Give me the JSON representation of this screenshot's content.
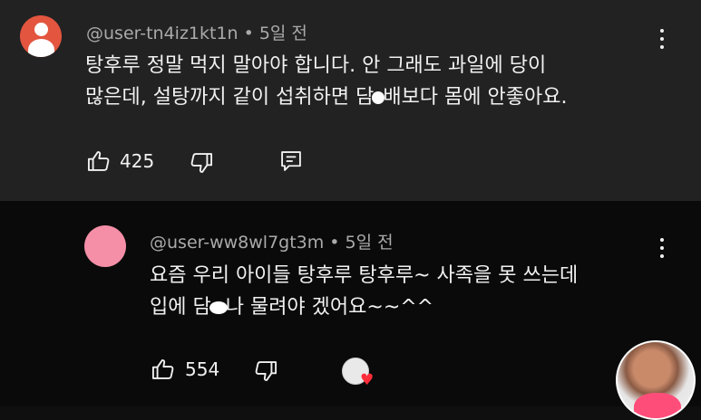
{
  "comments": [
    {
      "author": "@user-tn4iz1kt1n",
      "time": "5일 전",
      "line1": "탕후루 정말 먹지 말아야 합니다. 안 그래도 과일에 당이",
      "line2_a": "많은데, 설탕까지 같이 섭취하면 담",
      "line2_b": "배보다 몸에 안좋아요.",
      "likes": "425"
    },
    {
      "author": "@user-ww8wl7gt3m",
      "time": "5일 전",
      "line1": "요즘 우리 아이들 탕후루 탕후루~ 사족을 못 쓰는데",
      "line2_a": "입에 담",
      "line2_b": "나 물려야 겠어요~~^^",
      "likes": "554"
    }
  ],
  "colors": {
    "top_bg": "#222222",
    "bottom_bg": "#0a0a0a",
    "avatar_default": "#e3553f",
    "avatar_pink": "#f58fa8",
    "meta_text": "#aaaaaa",
    "heart": "#ff2d3a"
  },
  "icons": {
    "like": "thumbs-up-icon",
    "dislike": "thumbs-down-icon",
    "reply": "reply-icon",
    "more": "more-vert-icon",
    "creator_heart": "creator-heart-icon"
  }
}
